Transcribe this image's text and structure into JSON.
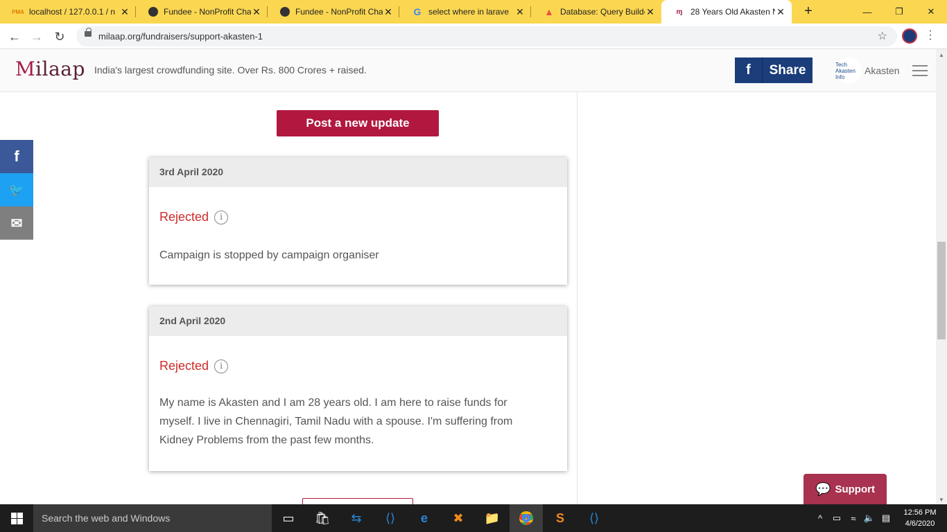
{
  "browser": {
    "tabs": [
      {
        "title": "localhost / 127.0.0.1 / n",
        "icon": "phpmyadmin-icon"
      },
      {
        "title": "Fundee - NonProfit Cha",
        "icon": "globe-icon"
      },
      {
        "title": "Fundee - NonProfit Cha",
        "icon": "globe-icon"
      },
      {
        "title": "select where in larave",
        "icon": "google-icon"
      },
      {
        "title": "Database: Query Builde",
        "icon": "laravel-icon"
      },
      {
        "title": "28 Years Old Akasten N",
        "icon": "milaap-icon"
      }
    ],
    "new_tab_label": "+",
    "url": "milaap.org/fundraisers/support-akasten-1"
  },
  "site": {
    "logo_text": "ilaap",
    "logo_initial": "M",
    "tagline": "India's largest crowdfunding site. Over Rs. 800 Crores + raised.",
    "share_label": "Share",
    "share_icon": "f",
    "avatar_text": "Tech Akasten Info",
    "username": "Akasten"
  },
  "main": {
    "post_update_label": "Post a new update",
    "updates": [
      {
        "date": "3rd April 2020",
        "status": "Rejected",
        "body": "Campaign is stopped by campaign organiser"
      },
      {
        "date": "2nd April 2020",
        "status": "Rejected",
        "body": "My name is Akasten and I am 28 years old. I am here to raise funds for myself. I live in Chennagiri, Tamil Nadu with a spouse. I'm suffering from Kidney Problems from the past few months."
      }
    ]
  },
  "social": {
    "facebook": "f",
    "twitter": "🐦",
    "email": "✉",
    "colors": {
      "facebook": "#3b5998",
      "twitter": "#1da1f2",
      "email": "#7f7f7f"
    }
  },
  "support_label": "Support",
  "taskbar": {
    "search_placeholder": "Search the web and Windows",
    "time": "12:56 PM",
    "date": "4/6/2020"
  },
  "colors": {
    "tabstrip": "#fbd751",
    "brand": "#b2183f",
    "rejected": "#d02a2a",
    "facebook_share": "#1b3d7a"
  }
}
